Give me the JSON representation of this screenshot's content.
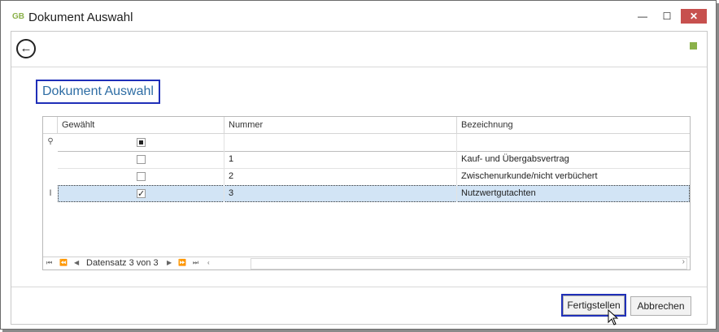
{
  "window": {
    "app_logo": "GB",
    "title": "Dokument Auswahl",
    "minimize": "—",
    "maximize": "☐",
    "close": "✕"
  },
  "page": {
    "heading": "Dokument Auswahl",
    "back_icon": "arrow-left-circle-icon"
  },
  "grid": {
    "columns": [
      "Gewählt",
      "Nummer",
      "Bezeichnung"
    ],
    "rows": [
      {
        "checked": false,
        "nummer": "1",
        "bezeichnung": "Kauf- und Übergabsvertrag"
      },
      {
        "checked": false,
        "nummer": "2",
        "bezeichnung": "Zwischenurkunde/nicht verbüchert"
      },
      {
        "checked": true,
        "nummer": "3",
        "bezeichnung": "Nutzwertgutachten"
      }
    ],
    "navigator_text": "Datensatz 3 von 3"
  },
  "buttons": {
    "finish": "Fertigstellen",
    "cancel": "Abbrechen"
  },
  "colors": {
    "accent_green": "#8bb14a",
    "selection": "#d2e4f5",
    "focus_border": "#1f2fb8"
  }
}
